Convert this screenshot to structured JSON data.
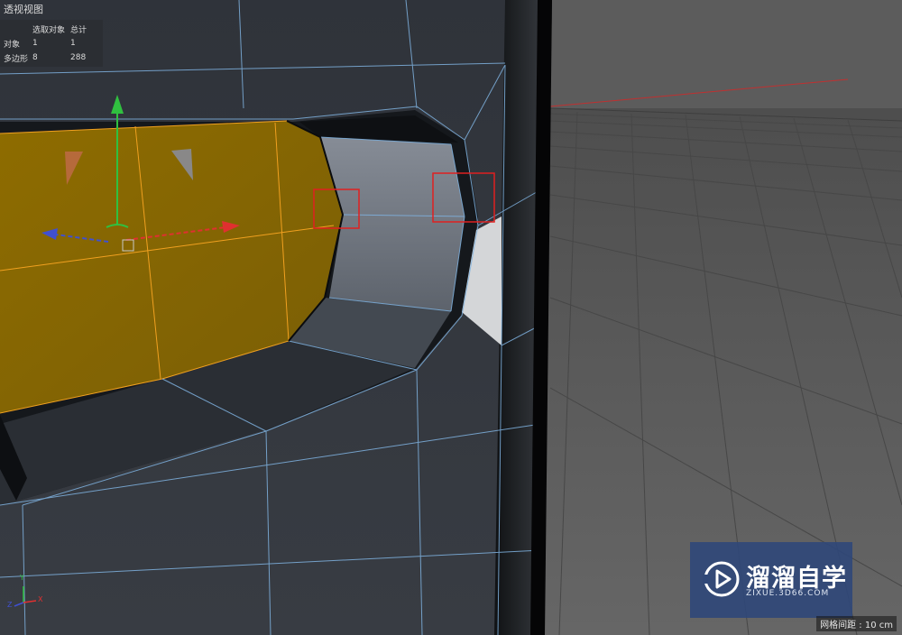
{
  "viewport": {
    "title": "透视视图",
    "grid_spacing": "网格间距 : 10 cm"
  },
  "stats": {
    "headers": [
      "",
      "选取对象",
      "总计"
    ],
    "rows": [
      {
        "label": "对象",
        "selected": "1",
        "total": "1"
      },
      {
        "label": "多边形",
        "selected": "8",
        "total": "288"
      }
    ]
  },
  "axis_gizmo": {
    "x": "X",
    "y": "Y",
    "z": "Z"
  },
  "watermark": {
    "name": "溜溜自学",
    "url": "ZIXUE.3D66.COM"
  },
  "colors": {
    "background": "#5a5a5a",
    "mesh": "#2c3036",
    "wire": "#7fb2e0",
    "selection": "#8a6a00",
    "selection_edge": "#f0a020",
    "highlight_box": "#e02020",
    "axis_x": "#e03030",
    "axis_y": "#30c040",
    "axis_z": "#3050e0"
  }
}
